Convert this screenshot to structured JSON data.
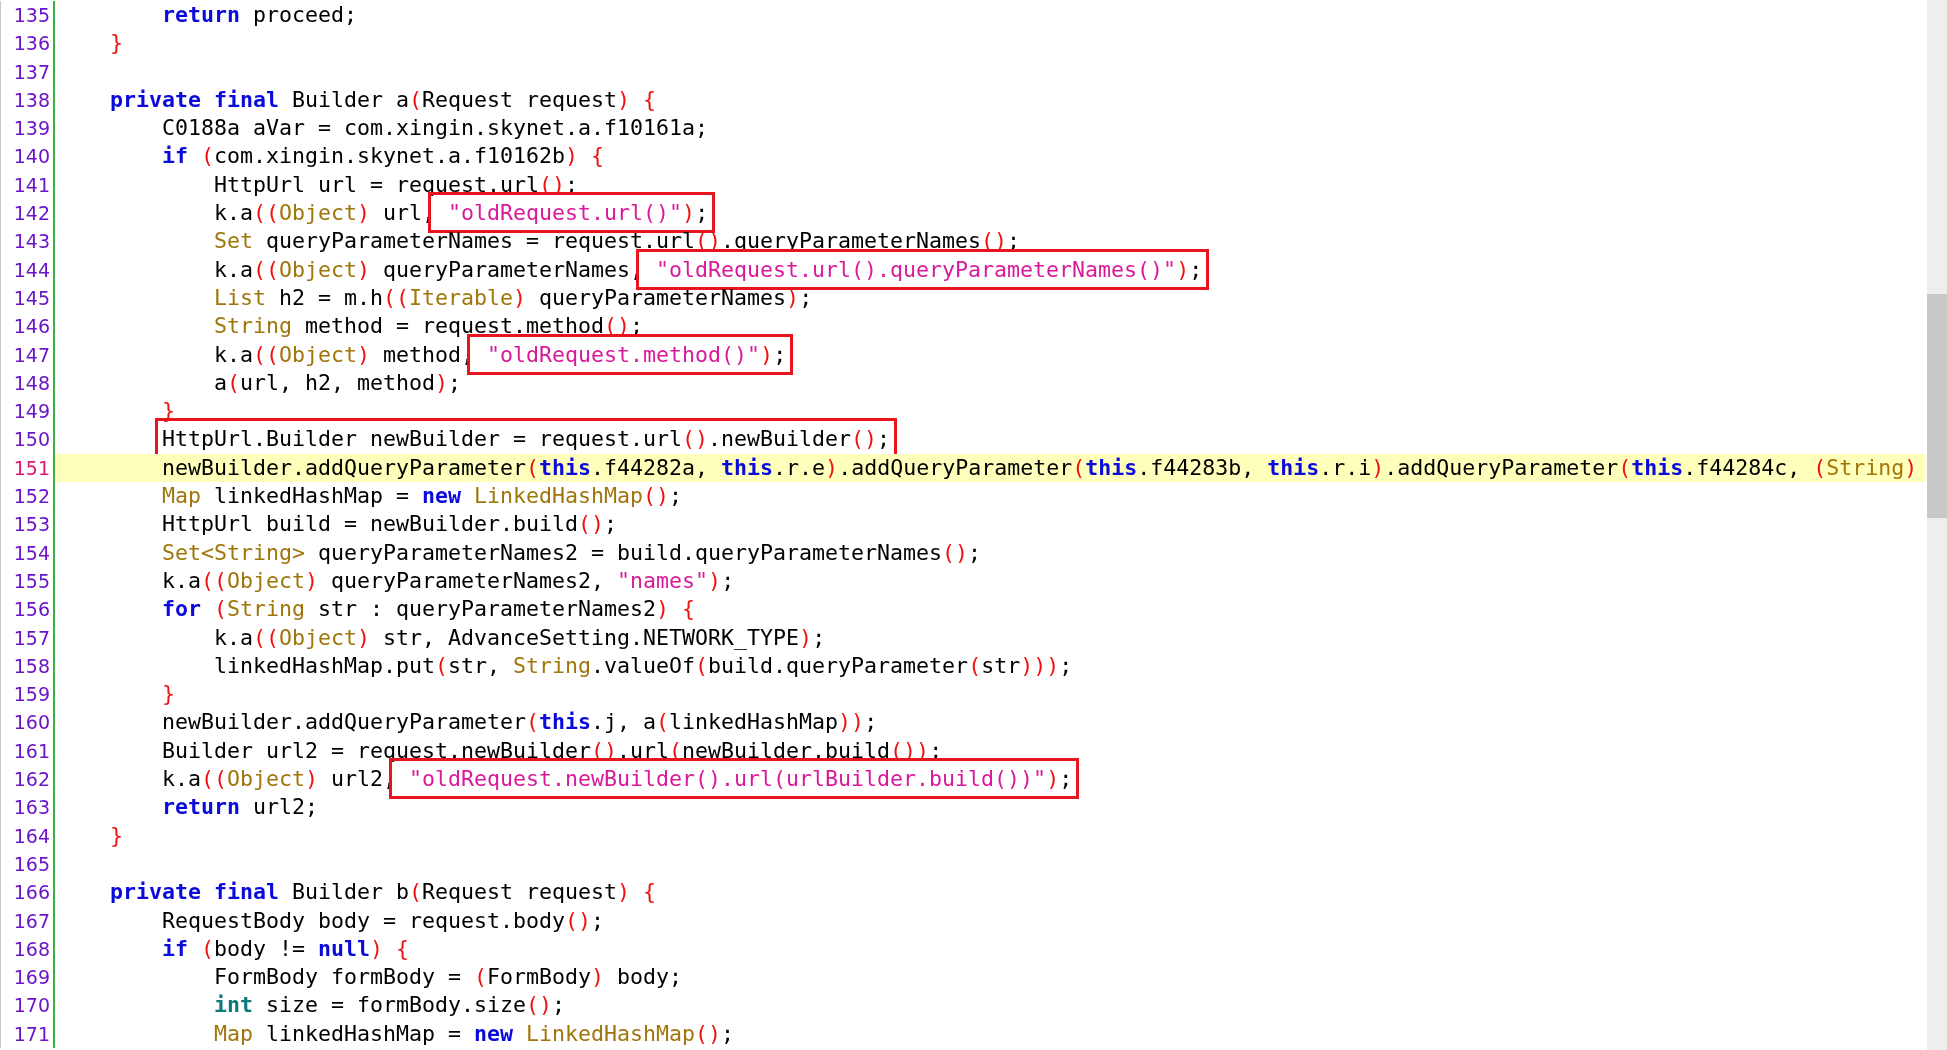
{
  "editor": {
    "lines": [
      {
        "number": "135",
        "current": false,
        "segments": [
          {
            "boxed": false,
            "tokens": [
              {
                "kind": "kw",
                "text": "        return"
              },
              {
                "kind": "plain",
                "text": " proceed;"
              }
            ]
          }
        ]
      },
      {
        "number": "136",
        "current": false,
        "segments": [
          {
            "boxed": false,
            "tokens": [
              {
                "kind": "br",
                "text": "    }"
              }
            ]
          }
        ]
      },
      {
        "number": "137",
        "current": false
      },
      {
        "number": "138",
        "current": false,
        "segments": [
          {
            "boxed": false,
            "tokens": [
              {
                "kind": "kw",
                "text": "    private final"
              },
              {
                "kind": "plain",
                "text": " Builder a"
              },
              {
                "kind": "br",
                "text": "("
              },
              {
                "kind": "plain",
                "text": "Request request"
              },
              {
                "kind": "br",
                "text": ") {"
              }
            ]
          }
        ]
      },
      {
        "number": "139",
        "current": false,
        "segments": [
          {
            "boxed": false,
            "tokens": [
              {
                "kind": "plain",
                "text": "        C0188a aVar = com.xingin.skynet.a.f10161a;"
              }
            ]
          }
        ]
      },
      {
        "number": "140",
        "current": false,
        "segments": [
          {
            "boxed": false,
            "tokens": [
              {
                "kind": "kw",
                "text": "        if"
              },
              {
                "kind": "br",
                "text": " ("
              },
              {
                "kind": "plain",
                "text": "com.xingin.skynet.a.f10162b"
              },
              {
                "kind": "br",
                "text": ") {"
              }
            ]
          }
        ]
      },
      {
        "number": "141",
        "current": false,
        "segments": [
          {
            "boxed": false,
            "tokens": [
              {
                "kind": "plain",
                "text": "            HttpUrl url = request.url"
              },
              {
                "kind": "br",
                "text": "()"
              },
              {
                "kind": "plain",
                "text": ";"
              }
            ]
          }
        ]
      },
      {
        "number": "142",
        "current": false,
        "segments": [
          {
            "boxed": false,
            "tokens": [
              {
                "kind": "plain",
                "text": "            k.a"
              },
              {
                "kind": "br",
                "text": "(("
              },
              {
                "kind": "type",
                "text": "Object"
              },
              {
                "kind": "br",
                "text": ")"
              },
              {
                "kind": "plain",
                "text": " url,"
              }
            ]
          },
          {
            "boxed": true,
            "tokens": [
              {
                "kind": "str",
                "text": " \"oldRequest.url()\""
              },
              {
                "kind": "br",
                "text": ")"
              },
              {
                "kind": "plain",
                "text": ";"
              }
            ]
          }
        ]
      },
      {
        "number": "143",
        "current": false,
        "segments": [
          {
            "boxed": false,
            "tokens": [
              {
                "kind": "type",
                "text": "            Set"
              },
              {
                "kind": "plain",
                "text": " queryParameterNames = request.url"
              },
              {
                "kind": "br",
                "text": "()"
              },
              {
                "kind": "plain",
                "text": ".queryParameterNames"
              },
              {
                "kind": "br",
                "text": "()"
              },
              {
                "kind": "plain",
                "text": ";"
              }
            ]
          }
        ]
      },
      {
        "number": "144",
        "current": false,
        "segments": [
          {
            "boxed": false,
            "tokens": [
              {
                "kind": "plain",
                "text": "            k.a"
              },
              {
                "kind": "br",
                "text": "(("
              },
              {
                "kind": "type",
                "text": "Object"
              },
              {
                "kind": "br",
                "text": ")"
              },
              {
                "kind": "plain",
                "text": " queryParameterNames,"
              }
            ]
          },
          {
            "boxed": true,
            "tokens": [
              {
                "kind": "str",
                "text": " \"oldRequest.url().queryParameterNames()\""
              },
              {
                "kind": "br",
                "text": ")"
              },
              {
                "kind": "plain",
                "text": ";"
              }
            ]
          }
        ]
      },
      {
        "number": "145",
        "current": false,
        "segments": [
          {
            "boxed": false,
            "tokens": [
              {
                "kind": "type",
                "text": "            List"
              },
              {
                "kind": "plain",
                "text": " h2 = m.h"
              },
              {
                "kind": "br",
                "text": "(("
              },
              {
                "kind": "type",
                "text": "Iterable"
              },
              {
                "kind": "br",
                "text": ")"
              },
              {
                "kind": "plain",
                "text": " queryParameterNames"
              },
              {
                "kind": "br",
                "text": ")"
              },
              {
                "kind": "plain",
                "text": ";"
              }
            ]
          }
        ]
      },
      {
        "number": "146",
        "current": false,
        "segments": [
          {
            "boxed": false,
            "tokens": [
              {
                "kind": "type",
                "text": "            String"
              },
              {
                "kind": "plain",
                "text": " method = request.method"
              },
              {
                "kind": "br",
                "text": "()"
              },
              {
                "kind": "plain",
                "text": ";"
              }
            ]
          }
        ]
      },
      {
        "number": "147",
        "current": false,
        "segments": [
          {
            "boxed": false,
            "tokens": [
              {
                "kind": "plain",
                "text": "            k.a"
              },
              {
                "kind": "br",
                "text": "(("
              },
              {
                "kind": "type",
                "text": "Object"
              },
              {
                "kind": "br",
                "text": ")"
              },
              {
                "kind": "plain",
                "text": " method,"
              }
            ]
          },
          {
            "boxed": true,
            "tokens": [
              {
                "kind": "str",
                "text": " \"oldRequest.method()\""
              },
              {
                "kind": "br",
                "text": ")"
              },
              {
                "kind": "plain",
                "text": ";"
              }
            ]
          }
        ]
      },
      {
        "number": "148",
        "current": false,
        "segments": [
          {
            "boxed": false,
            "tokens": [
              {
                "kind": "plain",
                "text": "            a"
              },
              {
                "kind": "br",
                "text": "("
              },
              {
                "kind": "plain",
                "text": "url, h2, method"
              },
              {
                "kind": "br",
                "text": ")"
              },
              {
                "kind": "plain",
                "text": ";"
              }
            ]
          }
        ]
      },
      {
        "number": "149",
        "current": false,
        "segments": [
          {
            "boxed": false,
            "tokens": [
              {
                "kind": "br",
                "text": "        }"
              }
            ]
          }
        ]
      },
      {
        "number": "150",
        "current": false,
        "segments": [
          {
            "boxed": true,
            "tokens": [
              {
                "kind": "plain",
                "text": "        HttpUrl.Builder newBuilder = request.url"
              },
              {
                "kind": "br",
                "text": "()"
              },
              {
                "kind": "plain",
                "text": ".newBuilder"
              },
              {
                "kind": "br",
                "text": "()"
              },
              {
                "kind": "plain",
                "text": ";"
              }
            ]
          }
        ]
      },
      {
        "number": "151",
        "current": true,
        "segments": [
          {
            "boxed": false,
            "tokens": [
              {
                "kind": "plain",
                "text": "        newBuilder.addQueryParameter"
              },
              {
                "kind": "br",
                "text": "("
              },
              {
                "kind": "kw",
                "text": "this"
              },
              {
                "kind": "plain",
                "text": ".f44282a, "
              },
              {
                "kind": "kw",
                "text": "this"
              },
              {
                "kind": "plain",
                "text": ".r.e"
              },
              {
                "kind": "br",
                "text": ")"
              },
              {
                "kind": "plain",
                "text": ".addQueryParameter"
              },
              {
                "kind": "br",
                "text": "("
              },
              {
                "kind": "kw",
                "text": "this"
              },
              {
                "kind": "plain",
                "text": ".f44283b, "
              },
              {
                "kind": "kw",
                "text": "this"
              },
              {
                "kind": "plain",
                "text": ".r.i"
              },
              {
                "kind": "br",
                "text": ")"
              },
              {
                "kind": "plain",
                "text": ".addQueryParameter"
              },
              {
                "kind": "br",
                "text": "("
              },
              {
                "kind": "kw",
                "text": "this"
              },
              {
                "kind": "plain",
                "text": ".f44284c,"
              },
              {
                "kind": "br",
                "text": " ("
              },
              {
                "kind": "type",
                "text": "String"
              },
              {
                "kind": "br",
                "text": ")"
              }
            ]
          }
        ]
      },
      {
        "number": "152",
        "current": false,
        "segments": [
          {
            "boxed": false,
            "tokens": [
              {
                "kind": "type",
                "text": "        Map"
              },
              {
                "kind": "plain",
                "text": " linkedHashMap ="
              },
              {
                "kind": "kw",
                "text": " new"
              },
              {
                "kind": "type",
                "text": " LinkedHashMap"
              },
              {
                "kind": "br",
                "text": "()"
              },
              {
                "kind": "plain",
                "text": ";"
              }
            ]
          }
        ]
      },
      {
        "number": "153",
        "current": false,
        "segments": [
          {
            "boxed": false,
            "tokens": [
              {
                "kind": "plain",
                "text": "        HttpUrl build = newBuilder.build"
              },
              {
                "kind": "br",
                "text": "()"
              },
              {
                "kind": "plain",
                "text": ";"
              }
            ]
          }
        ]
      },
      {
        "number": "154",
        "current": false,
        "segments": [
          {
            "boxed": false,
            "tokens": [
              {
                "kind": "type",
                "text": "        Set<String>"
              },
              {
                "kind": "plain",
                "text": " queryParameterNames2 = build.queryParameterNames"
              },
              {
                "kind": "br",
                "text": "()"
              },
              {
                "kind": "plain",
                "text": ";"
              }
            ]
          }
        ]
      },
      {
        "number": "155",
        "current": false,
        "segments": [
          {
            "boxed": false,
            "tokens": [
              {
                "kind": "plain",
                "text": "        k.a"
              },
              {
                "kind": "br",
                "text": "(("
              },
              {
                "kind": "type",
                "text": "Object"
              },
              {
                "kind": "br",
                "text": ")"
              },
              {
                "kind": "plain",
                "text": " queryParameterNames2,"
              },
              {
                "kind": "str",
                "text": " \"names\""
              },
              {
                "kind": "br",
                "text": ")"
              },
              {
                "kind": "plain",
                "text": ";"
              }
            ]
          }
        ]
      },
      {
        "number": "156",
        "current": false,
        "segments": [
          {
            "boxed": false,
            "tokens": [
              {
                "kind": "kw",
                "text": "        for"
              },
              {
                "kind": "br",
                "text": " ("
              },
              {
                "kind": "type",
                "text": "String"
              },
              {
                "kind": "plain",
                "text": " str : queryParameterNames2"
              },
              {
                "kind": "br",
                "text": ") {"
              }
            ]
          }
        ]
      },
      {
        "number": "157",
        "current": false,
        "segments": [
          {
            "boxed": false,
            "tokens": [
              {
                "kind": "plain",
                "text": "            k.a"
              },
              {
                "kind": "br",
                "text": "(("
              },
              {
                "kind": "type",
                "text": "Object"
              },
              {
                "kind": "br",
                "text": ")"
              },
              {
                "kind": "plain",
                "text": " str, AdvanceSetting.NETWORK_TYPE"
              },
              {
                "kind": "br",
                "text": ")"
              },
              {
                "kind": "plain",
                "text": ";"
              }
            ]
          }
        ]
      },
      {
        "number": "158",
        "current": false,
        "segments": [
          {
            "boxed": false,
            "tokens": [
              {
                "kind": "plain",
                "text": "            linkedHashMap.put"
              },
              {
                "kind": "br",
                "text": "("
              },
              {
                "kind": "plain",
                "text": "str, "
              },
              {
                "kind": "type",
                "text": "String"
              },
              {
                "kind": "plain",
                "text": ".valueOf"
              },
              {
                "kind": "br",
                "text": "("
              },
              {
                "kind": "plain",
                "text": "build.queryParameter"
              },
              {
                "kind": "br",
                "text": "("
              },
              {
                "kind": "plain",
                "text": "str"
              },
              {
                "kind": "br",
                "text": ")))"
              },
              {
                "kind": "plain",
                "text": ";"
              }
            ]
          }
        ]
      },
      {
        "number": "159",
        "current": false,
        "segments": [
          {
            "boxed": false,
            "tokens": [
              {
                "kind": "br",
                "text": "        }"
              }
            ]
          }
        ]
      },
      {
        "number": "160",
        "current": false,
        "segments": [
          {
            "boxed": false,
            "tokens": [
              {
                "kind": "plain",
                "text": "        newBuilder.addQueryParameter"
              },
              {
                "kind": "br",
                "text": "("
              },
              {
                "kind": "kw",
                "text": "this"
              },
              {
                "kind": "plain",
                "text": ".j, a"
              },
              {
                "kind": "br",
                "text": "("
              },
              {
                "kind": "plain",
                "text": "linkedHashMap"
              },
              {
                "kind": "br",
                "text": "))"
              },
              {
                "kind": "plain",
                "text": ";"
              }
            ]
          }
        ]
      },
      {
        "number": "161",
        "current": false,
        "segments": [
          {
            "boxed": false,
            "tokens": [
              {
                "kind": "plain",
                "text": "        Builder url2 = request.newBuilder"
              },
              {
                "kind": "br",
                "text": "()"
              },
              {
                "kind": "plain",
                "text": ".url"
              },
              {
                "kind": "br",
                "text": "("
              },
              {
                "kind": "plain",
                "text": "newBuilder.build"
              },
              {
                "kind": "br",
                "text": "())"
              },
              {
                "kind": "plain",
                "text": ";"
              }
            ]
          }
        ]
      },
      {
        "number": "162",
        "current": false,
        "segments": [
          {
            "boxed": false,
            "tokens": [
              {
                "kind": "plain",
                "text": "        k.a"
              },
              {
                "kind": "br",
                "text": "(("
              },
              {
                "kind": "type",
                "text": "Object"
              },
              {
                "kind": "br",
                "text": ")"
              },
              {
                "kind": "plain",
                "text": " url2,"
              }
            ]
          },
          {
            "boxed": true,
            "tokens": [
              {
                "kind": "str",
                "text": " \"oldRequest.newBuilder().url(urlBuilder.build())\""
              },
              {
                "kind": "br",
                "text": ")"
              },
              {
                "kind": "plain",
                "text": ";"
              }
            ]
          }
        ]
      },
      {
        "number": "163",
        "current": false,
        "segments": [
          {
            "boxed": false,
            "tokens": [
              {
                "kind": "kw",
                "text": "        return"
              },
              {
                "kind": "plain",
                "text": " url2;"
              }
            ]
          }
        ]
      },
      {
        "number": "164",
        "current": false,
        "segments": [
          {
            "boxed": false,
            "tokens": [
              {
                "kind": "br",
                "text": "    }"
              }
            ]
          }
        ]
      },
      {
        "number": "165",
        "current": false
      },
      {
        "number": "166",
        "current": false,
        "segments": [
          {
            "boxed": false,
            "tokens": [
              {
                "kind": "kw",
                "text": "    private final"
              },
              {
                "kind": "plain",
                "text": " Builder b"
              },
              {
                "kind": "br",
                "text": "("
              },
              {
                "kind": "plain",
                "text": "Request request"
              },
              {
                "kind": "br",
                "text": ") {"
              }
            ]
          }
        ]
      },
      {
        "number": "167",
        "current": false,
        "segments": [
          {
            "boxed": false,
            "tokens": [
              {
                "kind": "plain",
                "text": "        RequestBody body = request.body"
              },
              {
                "kind": "br",
                "text": "()"
              },
              {
                "kind": "plain",
                "text": ";"
              }
            ]
          }
        ]
      },
      {
        "number": "168",
        "current": false,
        "segments": [
          {
            "boxed": false,
            "tokens": [
              {
                "kind": "kw",
                "text": "        if"
              },
              {
                "kind": "br",
                "text": " ("
              },
              {
                "kind": "plain",
                "text": "body !="
              },
              {
                "kind": "kw",
                "text": " null"
              },
              {
                "kind": "br",
                "text": ") {"
              }
            ]
          }
        ]
      },
      {
        "number": "169",
        "current": false,
        "segments": [
          {
            "boxed": false,
            "tokens": [
              {
                "kind": "plain",
                "text": "            FormBody formBody ="
              },
              {
                "kind": "br",
                "text": " ("
              },
              {
                "kind": "plain",
                "text": "FormBody"
              },
              {
                "kind": "br",
                "text": ")"
              },
              {
                "kind": "plain",
                "text": " body;"
              }
            ]
          }
        ]
      },
      {
        "number": "170",
        "current": false,
        "segments": [
          {
            "boxed": false,
            "tokens": [
              {
                "kind": "prim",
                "text": "            int"
              },
              {
                "kind": "plain",
                "text": " size = formBody.size"
              },
              {
                "kind": "br",
                "text": "()"
              },
              {
                "kind": "plain",
                "text": ";"
              }
            ]
          }
        ]
      },
      {
        "number": "171",
        "current": false,
        "segments": [
          {
            "boxed": false,
            "tokens": [
              {
                "kind": "type",
                "text": "            Map"
              },
              {
                "kind": "plain",
                "text": " linkedHashMap ="
              },
              {
                "kind": "kw",
                "text": " new"
              },
              {
                "kind": "type",
                "text": " LinkedHashMap"
              },
              {
                "kind": "br",
                "text": "()"
              },
              {
                "kind": "plain",
                "text": ";"
              }
            ]
          }
        ]
      }
    ]
  }
}
